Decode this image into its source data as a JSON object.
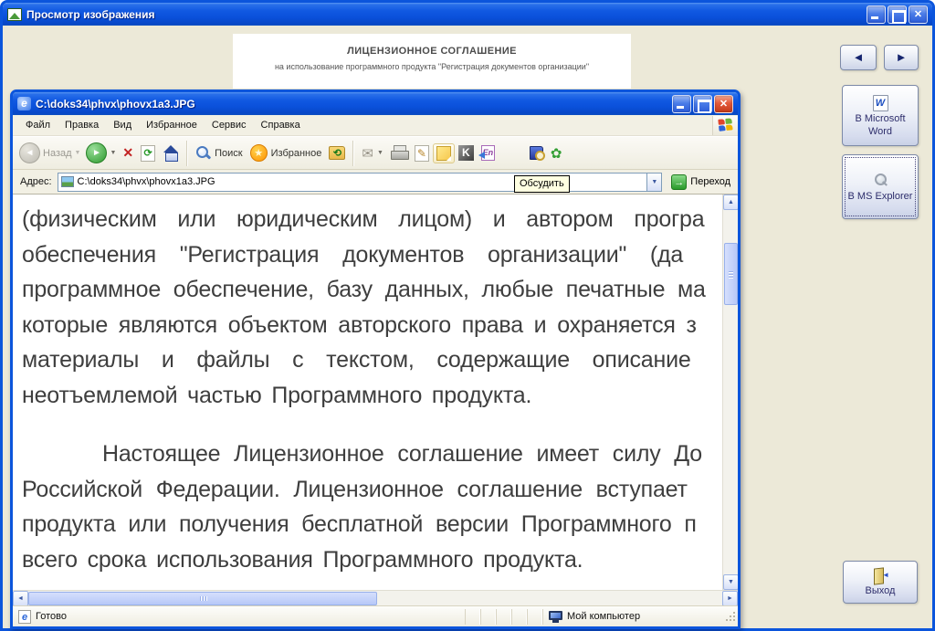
{
  "window": {
    "title": "Просмотр изображения"
  },
  "background_document": {
    "title": "ЛИЦЕНЗИОННОЕ СОГЛАШЕНИЕ",
    "subtitle": "на использование программного продукта \"Регистрация документов организации\""
  },
  "sidebar": {
    "word_button_line1": "В Microsoft",
    "word_button_line2": "Word",
    "explorer_button": "В MS Explorer",
    "exit_button": "Выход"
  },
  "ie": {
    "title": "C:\\doks34\\phvx\\phovx1a3.JPG",
    "menu": [
      "Файл",
      "Правка",
      "Вид",
      "Избранное",
      "Сервис",
      "Справка"
    ],
    "toolbar": {
      "back": "Назад",
      "search": "Поиск",
      "favorites": "Избранное"
    },
    "address": {
      "label": "Адрес:",
      "value": "C:\\doks34\\phvx\\phovx1a3.JPG",
      "go": "Переход"
    },
    "tooltip": "Обсудить",
    "content": {
      "lines": [
        {
          "text": "(физическим или юридическим лицом) и автором програ",
          "ws": 16
        },
        {
          "text": "обеспечения \"Регистрация документов организации\" (да",
          "ws": 19
        },
        {
          "text": "программное обеспечение, базу данных, любые печатные ма",
          "ws": 7
        },
        {
          "text": "которые являются объектом авторского права и охраняется з",
          "ws": 5
        },
        {
          "text": "материалы и файлы с текстом, содержащие описание",
          "ws": 18
        },
        {
          "text": "неотъемлемой частью Программного продукта.",
          "ws": 4,
          "gap_after": true
        },
        {
          "text": "Настоящее Лицензионное соглашение имеет силу До",
          "ws": 8,
          "indent": 88
        },
        {
          "text": "Российской Федерации. Лицензионное соглашение вступает",
          "ws": 8
        },
        {
          "text": "продукта или получения бесплатной версии Программного п",
          "ws": 7
        },
        {
          "text": "всего срока использования Программного продукта.",
          "ws": 4
        }
      ]
    },
    "status": {
      "ready": "Готово",
      "zone": "Мой компьютер"
    }
  },
  "icons": {
    "close": "✕",
    "nav_left": "◄",
    "nav_right": "►",
    "caret": "▼",
    "stop": "✕",
    "refresh": "⟳",
    "history": "⟲",
    "mail": "✉",
    "edit": "✎",
    "star": "★",
    "flower": "✿",
    "word_letter": "W",
    "kaspersky_letter": "K",
    "translate_label": "En",
    "ie_letter": "e",
    "go_arrow": "→",
    "arrow_up": "▲",
    "arrow_down": "▼",
    "arrow_left": "◄",
    "arrow_right": "►"
  }
}
